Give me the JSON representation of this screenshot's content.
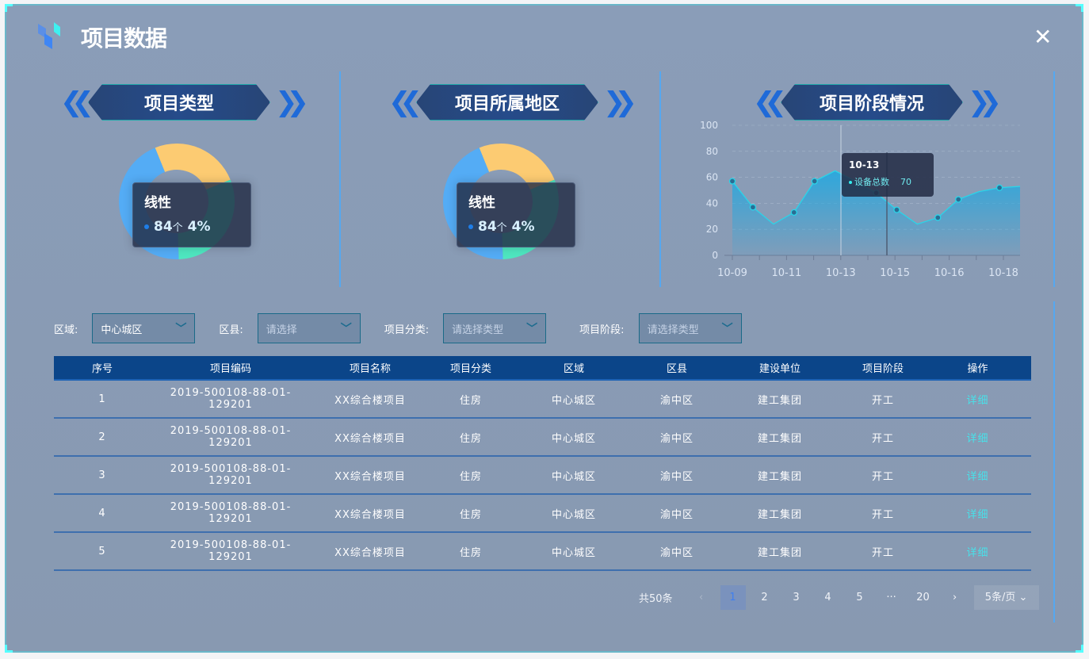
{
  "header": {
    "title": "项目数据",
    "close_icon": "close-icon"
  },
  "panels": [
    {
      "title": "项目类型",
      "tooltip": {
        "name": "线性",
        "count": "84",
        "unit": "个",
        "percent": "4%"
      }
    },
    {
      "title": "项目所属地区",
      "tooltip": {
        "name": "线性",
        "count": "84",
        "unit": "个",
        "percent": "4%"
      }
    },
    {
      "title": "项目阶段情况"
    }
  ],
  "donut_colors": [
    "#fccb72",
    "#4ee6c0",
    "#54acf5"
  ],
  "chart_data": {
    "type": "area",
    "ylim": [
      0,
      100
    ],
    "yticks": [
      "0",
      "20",
      "40",
      "60",
      "80",
      "100"
    ],
    "xticks": [
      "10-09",
      "10-11",
      "10-13",
      "10-15",
      "10-16",
      "10-18"
    ],
    "values": [
      57,
      37,
      24,
      33,
      57,
      65,
      57,
      48,
      35,
      24,
      29,
      43,
      49,
      52,
      53
    ],
    "markers": [
      true,
      true,
      false,
      true,
      true,
      false,
      false,
      true,
      true,
      false,
      true,
      true,
      false,
      true,
      false
    ],
    "grid": true,
    "tooltip": {
      "title": "10-13",
      "series": "设备总数",
      "value": "70"
    },
    "color": "#2ad4e8"
  },
  "filters": [
    {
      "label": "区域:",
      "value": "中心城区",
      "placeholder": false
    },
    {
      "label": "区县:",
      "value": "请选择",
      "placeholder": true
    },
    {
      "label": "项目分类:",
      "value": "请选择类型",
      "placeholder": true
    },
    {
      "label": "项目阶段:",
      "value": "请选择类型",
      "placeholder": true
    }
  ],
  "table": {
    "columns": [
      "序号",
      "项目编码",
      "项目名称",
      "项目分类",
      "区域",
      "区县",
      "建设单位",
      "项目阶段",
      "操作"
    ],
    "rows": [
      [
        "1",
        "2019-500108-88-01-129201",
        "XX综合楼项目",
        "住房",
        "中心城区",
        "渝中区",
        "建工集团",
        "开工",
        "详细"
      ],
      [
        "2",
        "2019-500108-88-01-129201",
        "XX综合楼项目",
        "住房",
        "中心城区",
        "渝中区",
        "建工集团",
        "开工",
        "详细"
      ],
      [
        "3",
        "2019-500108-88-01-129201",
        "XX综合楼项目",
        "住房",
        "中心城区",
        "渝中区",
        "建工集团",
        "开工",
        "详细"
      ],
      [
        "4",
        "2019-500108-88-01-129201",
        "XX综合楼项目",
        "住房",
        "中心城区",
        "渝中区",
        "建工集团",
        "开工",
        "详细"
      ],
      [
        "5",
        "2019-500108-88-01-129201",
        "XX综合楼项目",
        "住房",
        "中心城区",
        "渝中区",
        "建工集团",
        "开工",
        "详细"
      ]
    ]
  },
  "pagination": {
    "total": "共50条",
    "prev": "‹",
    "pages": [
      "1",
      "2",
      "3",
      "4",
      "5",
      "···",
      "20"
    ],
    "current": "1",
    "next": "›",
    "page_size": "5条/页"
  }
}
